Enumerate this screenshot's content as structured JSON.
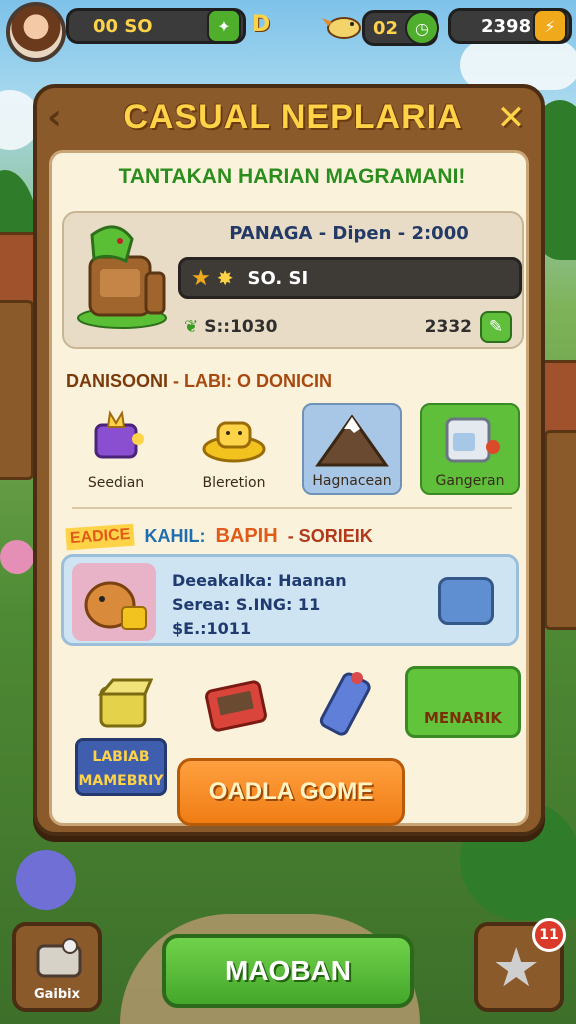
{
  "hud": {
    "coins": "00 SO",
    "coins_badge": "D",
    "energy": "02",
    "gems": "2398"
  },
  "panel": {
    "title": "CASUAL NEPLARIA",
    "subtitle": "TANTAKAN HARIAN MAGRAMANI!",
    "reward": {
      "title": "PANAGA - Dipen - 2:000",
      "bar_value": "SO. SI",
      "left_value": "S::1030",
      "right_value": "2332"
    },
    "shop": {
      "heading_a": "DANISOONI",
      "heading_b": "- LABI: O DONICIN",
      "items": [
        {
          "label": "Seedian",
          "icon": "purple-chest-icon"
        },
        {
          "label": "Bleretion",
          "icon": "gold-cat-bowl-icon"
        },
        {
          "label": "Hagnacean",
          "icon": "mountain-icon"
        },
        {
          "label": "Gangeran",
          "icon": "washing-machine-icon"
        }
      ]
    },
    "tasks": {
      "tag": "EADICE",
      "heading_a": "KAHIL:",
      "heading_b": "BAPIH",
      "heading_c": "- SORIEIK"
    },
    "offer": {
      "line1": "Deeakalka: Haanan",
      "line2": "Serea: S.ING: 11",
      "line3": "$E.:1011"
    },
    "menarik_label": "MENARIK",
    "membership_label": "LABIAB MAMEBRIY",
    "play_label": "OADLA GOME"
  },
  "bottom_nav": {
    "left_label": "Gaibix",
    "main_label": "MAOBAN",
    "badge_count": "11"
  },
  "colors": {
    "accent_gold": "#ffd347",
    "panel_wood": "#8b5a2b",
    "primary_green": "#45a72b",
    "play_orange": "#f07d14"
  }
}
